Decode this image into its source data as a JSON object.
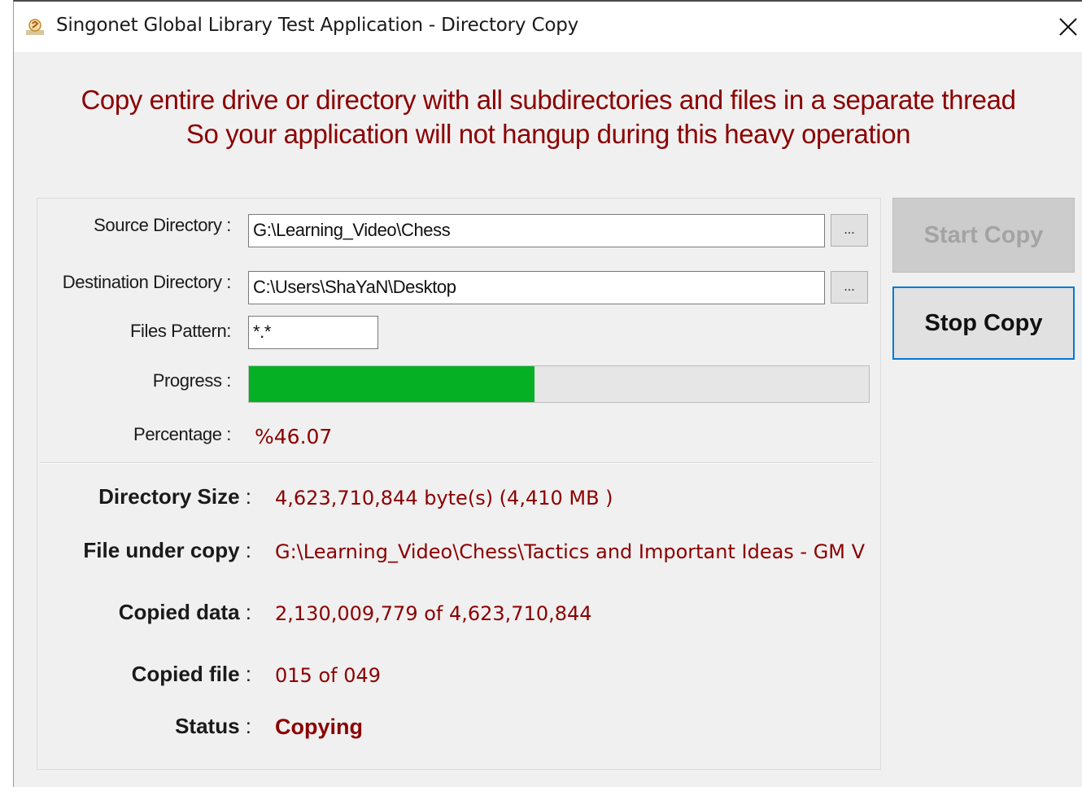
{
  "window": {
    "title": "Singonet Global Library Test Application - Directory Copy",
    "icon": "app-icon",
    "close_icon": "close-icon"
  },
  "headline": {
    "line1": "Copy entire drive or directory with all subdirectories and files in a separate thread",
    "line2": "So your application will not hangup during this heavy operation"
  },
  "form": {
    "source_label": "Source Directory :",
    "source_value": "G:\\Learning_Video\\Chess",
    "destination_label": "Destination Directory :",
    "destination_value": "C:\\Users\\ShaYaN\\Desktop",
    "browse_label": "...",
    "pattern_label": "Files Pattern:",
    "pattern_value": "*.*",
    "progress_label": "Progress :",
    "progress_fraction": 0.4607,
    "progress_color": "#06b025",
    "percentage_label": "Percentage :",
    "percentage_value": "%46.07"
  },
  "info": {
    "dir_size_label": "Directory Size",
    "dir_size_value": "4,623,710,844 byte(s)    (4,410 MB )",
    "file_label": "File under copy",
    "file_value": "G:\\Learning_Video\\Chess\\Tactics and Important Ideas - GM V",
    "copied_data_label": "Copied data",
    "copied_data_value": "2,130,009,779 of 4,623,710,844",
    "copied_file_label": "Copied file",
    "copied_file_value": "015 of 049",
    "status_label": "Status",
    "status_value": "Copying",
    "colon": " :",
    "value_color": "#8b0000"
  },
  "buttons": {
    "start_label": "Start Copy",
    "start_enabled": false,
    "stop_label": "Stop Copy",
    "focus_color": "#0078d7"
  }
}
